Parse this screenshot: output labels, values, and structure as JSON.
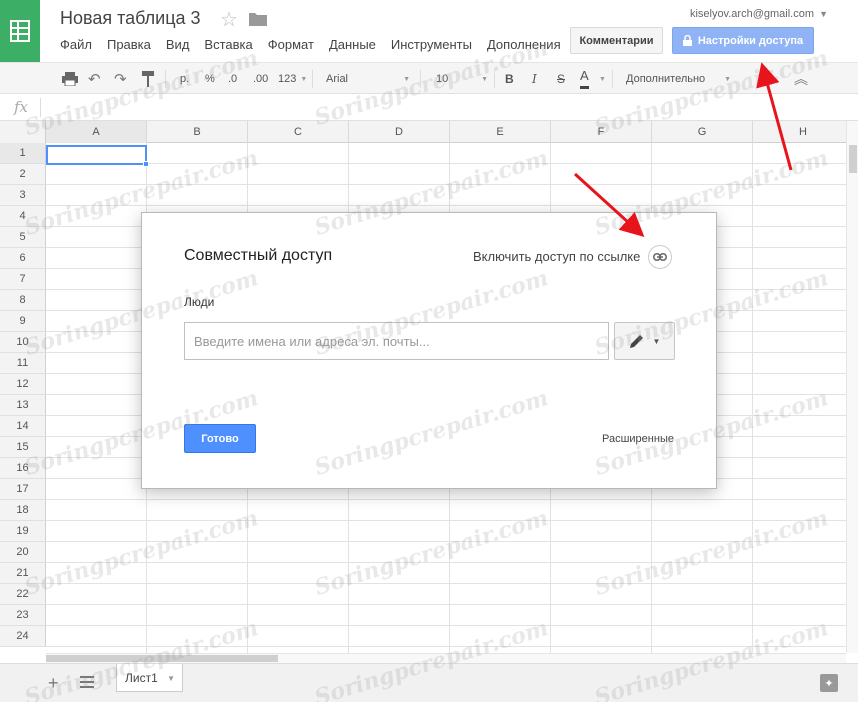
{
  "header": {
    "doc_title": "Новая таблица 3",
    "user_email": "kiselyov.arch@gmail.com",
    "menu": [
      "Файл",
      "Правка",
      "Вид",
      "Вставка",
      "Формат",
      "Данные",
      "Инструменты",
      "Дополнения"
    ],
    "comments_label": "Комментарии",
    "share_label": "Настройки доступа"
  },
  "toolbar": {
    "currency": "р.",
    "percent": "%",
    "dec_decrease": ".0",
    "dec_increase": ".00",
    "number_format": "123",
    "font_name": "Arial",
    "font_size": "10",
    "bold": "B",
    "italic": "I",
    "strike": "S",
    "text_color": "A",
    "more_label": "Дополнительно"
  },
  "formula_bar": {
    "fx": "fx"
  },
  "grid": {
    "columns": [
      "A",
      "B",
      "C",
      "D",
      "E",
      "F",
      "G",
      "H"
    ],
    "rows": [
      "1",
      "2",
      "3",
      "4",
      "5",
      "6",
      "7",
      "8",
      "9",
      "10",
      "11",
      "12",
      "13",
      "14",
      "15",
      "16",
      "17",
      "18",
      "19",
      "20",
      "21",
      "22",
      "23",
      "24"
    ]
  },
  "dialog": {
    "title": "Совместный доступ",
    "link_share_label": "Включить доступ по ссылке",
    "people_label": "Люди",
    "people_placeholder": "Введите имена или адреса эл. почты...",
    "done_label": "Готово",
    "advanced_label": "Расширенные"
  },
  "sheets": {
    "active_tab": "Лист1"
  },
  "watermark": "Soringpcrepair.com",
  "colors": {
    "brand_green": "#3cae66",
    "accent_blue": "#4d90fe",
    "share_button_disabled": "#8fb3f5",
    "arrow_red": "#e8141c"
  }
}
